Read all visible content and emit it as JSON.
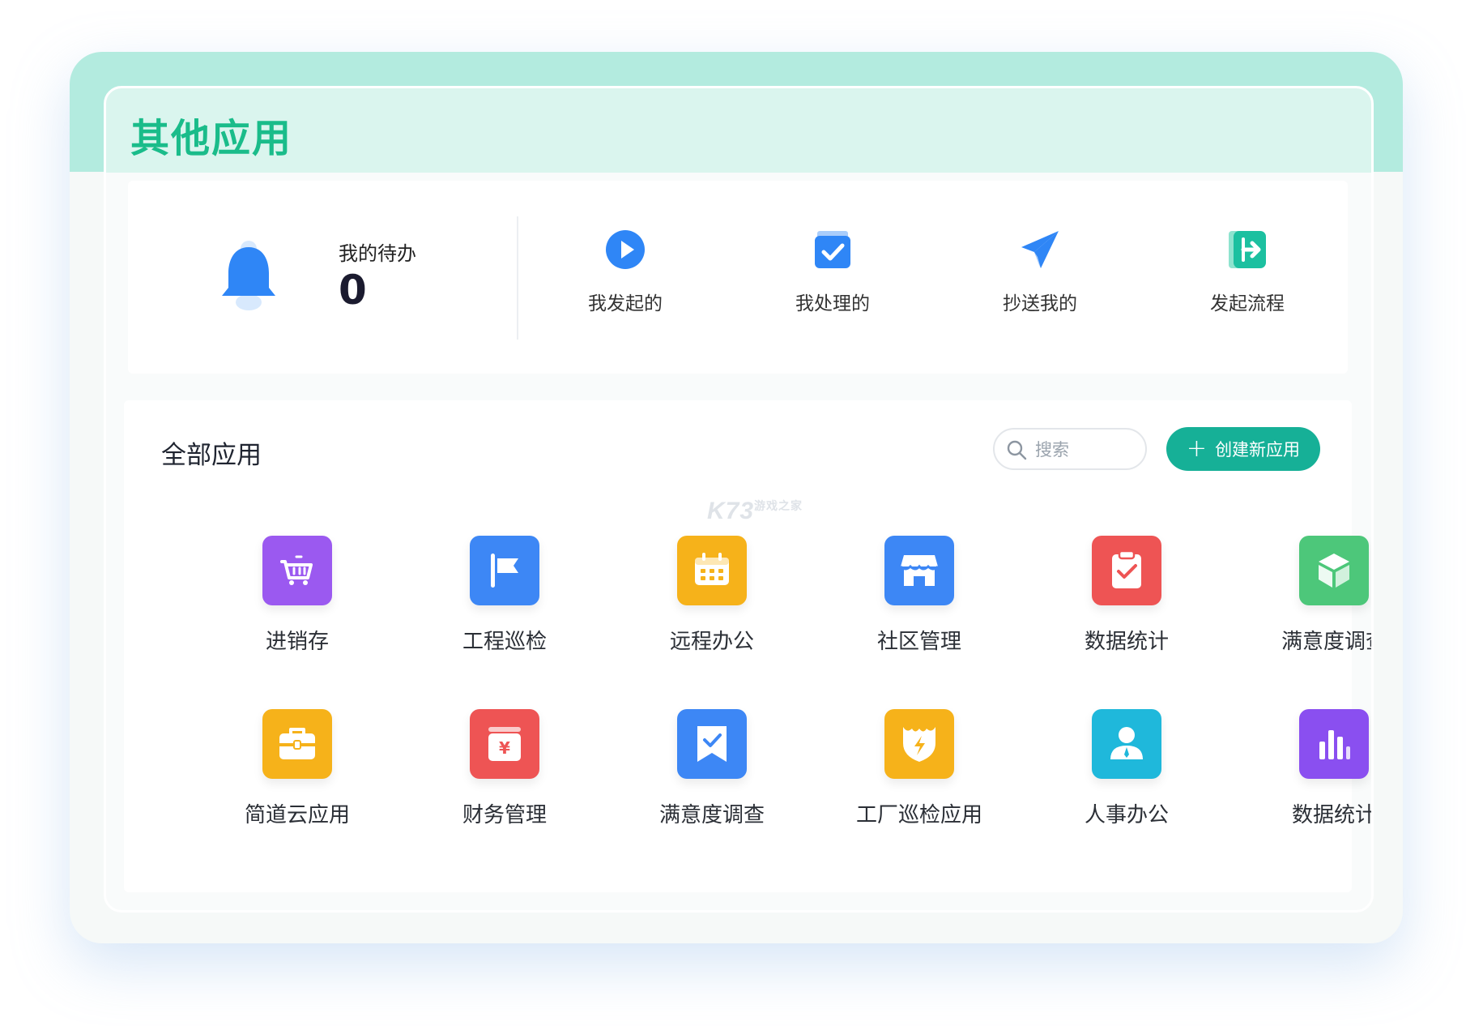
{
  "colors": {
    "accent": "#16b097",
    "title": "#1abc8a",
    "header_band": "#b3ebdf",
    "bell": "#2f86f6"
  },
  "page": {
    "title": "其他应用"
  },
  "todo": {
    "label": "我的待办",
    "count": "0",
    "icon": "bell-icon"
  },
  "quick_actions": [
    {
      "label": "我发起的",
      "icon": "play-circle-icon"
    },
    {
      "label": "我处理的",
      "icon": "check-box-icon"
    },
    {
      "label": "抄送我的",
      "icon": "paper-plane-icon"
    },
    {
      "label": "发起流程",
      "icon": "exit-arrow-icon"
    }
  ],
  "apps_section": {
    "title": "全部应用",
    "search_placeholder": "搜索",
    "create_label": "创建新应用"
  },
  "apps": [
    {
      "label": "进销存",
      "icon": "shopping-cart-icon",
      "color": "#9b59f0"
    },
    {
      "label": "工程巡检",
      "icon": "flag-icon",
      "color": "#3d87f5"
    },
    {
      "label": "远程办公",
      "icon": "calendar-icon",
      "color": "#f6b21a"
    },
    {
      "label": "社区管理",
      "icon": "store-icon",
      "color": "#3d87f5"
    },
    {
      "label": "数据统计",
      "icon": "clipboard-check-icon",
      "color": "#ee5454"
    },
    {
      "label": "满意度调查",
      "icon": "cube-icon",
      "color": "#4dc77a"
    },
    {
      "label": "简道云应用",
      "icon": "briefcase-icon",
      "color": "#f6b21a"
    },
    {
      "label": "财务管理",
      "icon": "yuan-box-icon",
      "color": "#ee5454"
    },
    {
      "label": "满意度调查",
      "icon": "bookmark-check-icon",
      "color": "#3d87f5"
    },
    {
      "label": "工厂巡检应用",
      "icon": "shield-bolt-icon",
      "color": "#f6b21a"
    },
    {
      "label": "人事办公",
      "icon": "user-icon",
      "color": "#1fb8db"
    },
    {
      "label": "数据统计",
      "icon": "bar-chart-icon",
      "color": "#8a4ff0"
    }
  ],
  "watermark": {
    "text": "K73",
    "sub": "游戏之家"
  }
}
